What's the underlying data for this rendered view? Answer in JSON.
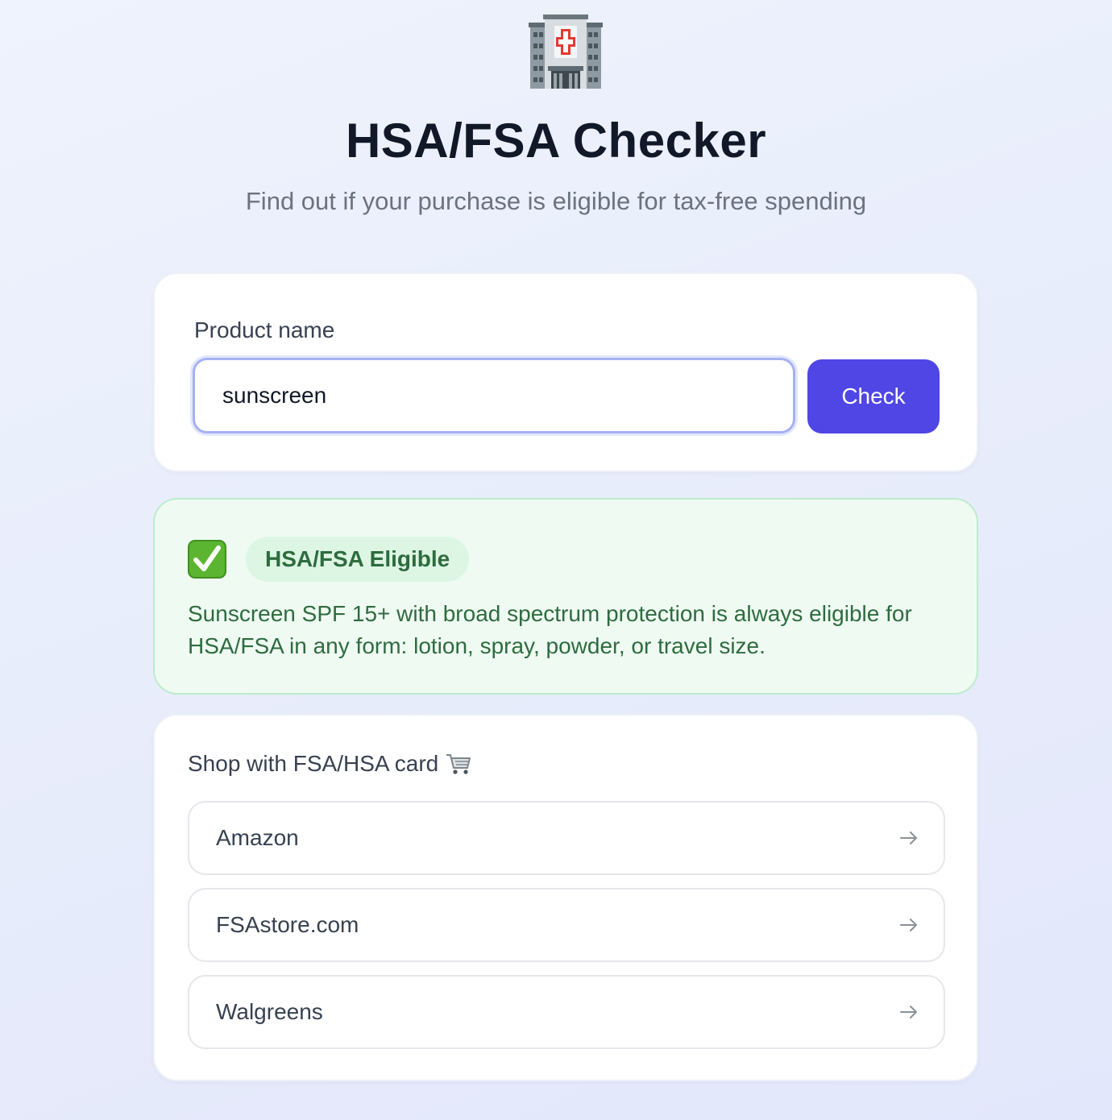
{
  "header": {
    "title": "HSA/FSA Checker",
    "subtitle": "Find out if your purchase is eligible for tax-free spending",
    "logo_icon": "hospital-icon"
  },
  "search": {
    "label": "Product name",
    "value": "sunscreen",
    "button_label": "Check"
  },
  "result": {
    "status_icon": "check-mark-button-icon",
    "badge": "HSA/FSA Eligible",
    "description": "Sunscreen SPF 15+ with broad spectrum protection is always eligible for HSA/FSA in any form: lotion, spray, powder, or travel size.",
    "status_color": "#2f6b40"
  },
  "shop": {
    "heading": "Shop with FSA/HSA card",
    "heading_icon": "shopping-cart-icon",
    "stores": [
      {
        "name": "Amazon",
        "icon": "arrow-right-icon"
      },
      {
        "name": "FSAstore.com",
        "icon": "arrow-right-icon"
      },
      {
        "name": "Walgreens",
        "icon": "arrow-right-icon"
      }
    ]
  },
  "colors": {
    "accent": "#4f46e5",
    "success_bg": "#effbf2",
    "success_badge_bg": "#dcf6e3"
  }
}
